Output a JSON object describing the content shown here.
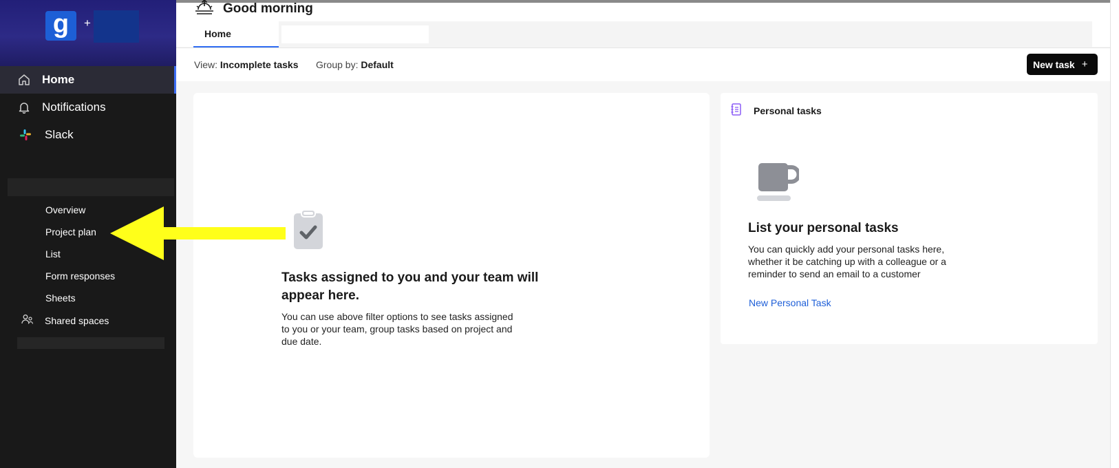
{
  "app": {
    "logo_letter": "g",
    "add_symbol": "+"
  },
  "sidebar": {
    "nav": [
      {
        "label": "Home",
        "icon": "home-icon",
        "active": true
      },
      {
        "label": "Notifications",
        "icon": "bell-icon",
        "active": false
      },
      {
        "label": "Slack",
        "icon": "slack-icon",
        "active": false
      }
    ],
    "sub_items": [
      "Overview",
      "Project plan",
      "List",
      "Form responses",
      "Sheets"
    ],
    "shared_spaces": "Shared spaces"
  },
  "header": {
    "greeting": "Good morning",
    "tabs": [
      {
        "label": "Home",
        "active": true
      }
    ]
  },
  "filters": {
    "view_label": "View:",
    "view_value": "Incomplete tasks",
    "group_label": "Group by:",
    "group_value": "Default",
    "new_task": "New task",
    "new_task_icon": "+"
  },
  "main": {
    "heading": "Tasks assigned to you and your team will appear here.",
    "description": "You can use above filter options to see tasks assigned to you or your team, group tasks based on project and due date."
  },
  "personal": {
    "title": "Personal tasks",
    "heading": "List your personal tasks",
    "description": "You can quickly add your personal tasks here, whether it be catching up with a colleague or a reminder to send an email to a customer",
    "link": "New Personal Task"
  },
  "colors": {
    "accent": "#2f6cf3",
    "sidebar_bg": "#191919",
    "annotation_arrow": "#ffff1a",
    "link": "#1e5fd8",
    "personal_icon": "#8b5cf6"
  }
}
